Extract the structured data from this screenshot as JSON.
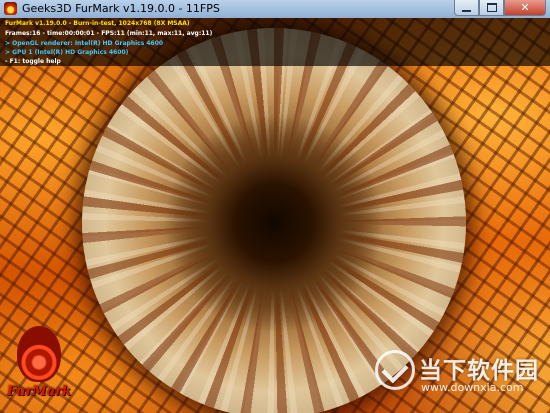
{
  "window": {
    "title": "Geeks3D FurMark v1.19.0.0 - 11FPS",
    "icon": "furmark-app-icon",
    "controls": {
      "minimize_icon": "minimize-icon",
      "maximize_icon": "maximize-icon",
      "close_icon": "close-icon",
      "close_glyph": "✕"
    }
  },
  "osd": {
    "line1": "FurMark v1.19.0.0 - Burn-in-test, 1024x768 (8X MSAA)",
    "line2": "Frames:16 - time:00:00:01 - FPS:11 (min:11, max:11, avg:11)",
    "line3": "> OpenGL renderer: Intel(R) HD Graphics 4600",
    "line4": "> GPU 1 (Intel(R) HD Graphics 4600)",
    "line5": "- F1: toggle help",
    "colors": {
      "title": "#ffe000",
      "stats": "#ffffff",
      "gpu": "#41c8ff"
    }
  },
  "logos": {
    "furmark": "FurMark",
    "watermark_cn": "当下软件园",
    "watermark_url": "www.downxia.com"
  }
}
